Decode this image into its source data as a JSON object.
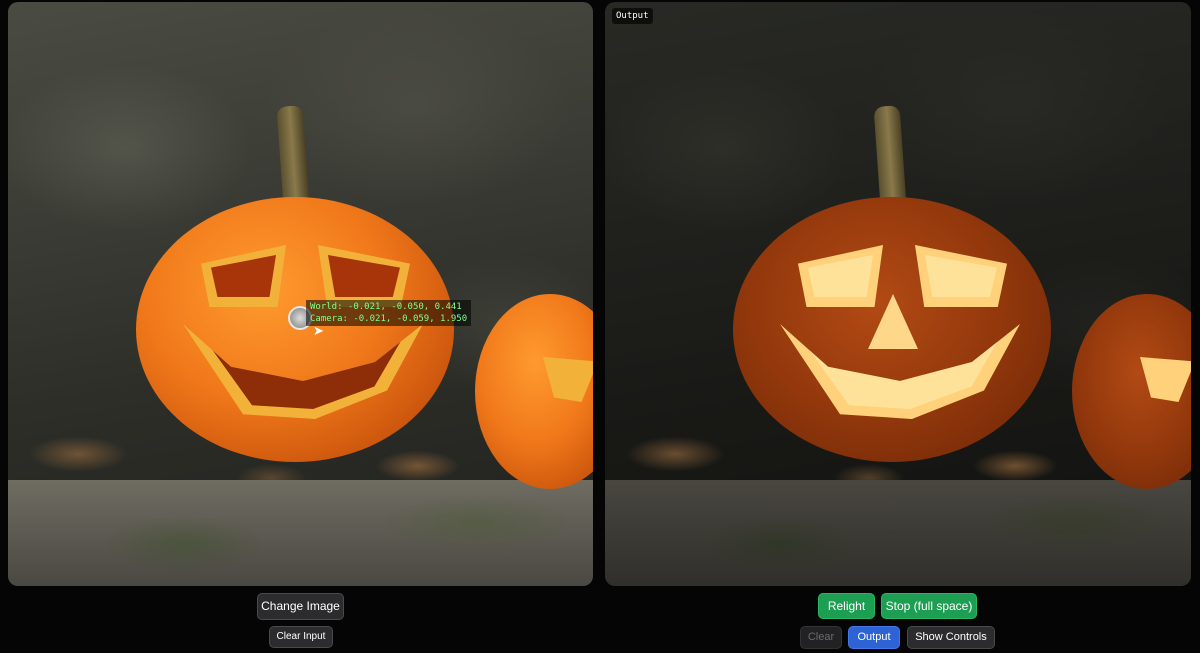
{
  "input_panel": {
    "probe": {
      "world_label": "World: -0.021, -0.050, 0.441",
      "camera_label": "Camera: -0.021, -0.059, 1.950"
    }
  },
  "output_panel": {
    "tag": "Output"
  },
  "input_controls": {
    "change_image": "Change Image",
    "clear_input": "Clear Input"
  },
  "output_controls": {
    "relight": "Relight",
    "stop": "Stop (full space)",
    "clear": "Clear",
    "output": "Output",
    "show_controls": "Show Controls"
  },
  "colors": {
    "background": "#050505",
    "green_button": "#1e9e52",
    "blue_button": "#2e63d6",
    "gray_button": "#2c2c2e",
    "coord_text": "#7dff8a"
  }
}
